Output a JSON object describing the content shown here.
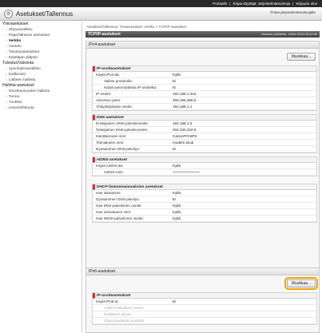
{
  "topbar": {
    "links": [
      "Portaalin",
      "Kirjaa käyttäjä: Järjestelmänvalvoja",
      "Kirjaudu ulos"
    ]
  },
  "header": {
    "title": "Asetukset/Tallennus",
    "admin_link": "Posta järjestelmänvalvojalle"
  },
  "sidebar": {
    "groups": [
      {
        "label": "Yleisasetukset",
        "items": [
          "Ohjausvalikko",
          "Paperilähteen asetukset",
          "Verkko",
          "Asetelu",
          "Tulostusasetukset",
          "Käyttäjän ylläpito"
        ]
      },
      {
        "label": "Tulostus/Valvonta",
        "items": [
          "Apuohjelmavalikko",
          "Kalibrointi",
          "Laitteen hallinta"
        ]
      },
      {
        "label": "Hallinta-asetukset",
        "items": [
          "Osoitetunnusten hallinta",
          "Tunna",
          "TunRite",
          "Lisenssi/Muuta"
        ]
      }
    ],
    "active": "Verkko"
  },
  "main": {
    "breadcrumb": "Asetukset/Tallennus: Yleisasetukset: Verkko > TCP/IP-asetukset",
    "title": "TCP/IP-asetukset",
    "updated": "Viimeksi päivitetty: 19/06 2019 05:41:50",
    "edit_label": "Muokkaa...",
    "ipv4": {
      "panel_title": "IPv4-asetukset",
      "ip_section": {
        "title": "IP-osoiteasetukset",
        "rows": [
          {
            "label": "Käytä IPv4:ää:",
            "value": "Kyllä",
            "indent": false
          },
          {
            "label": "Valitse protokolla:",
            "value": "Ei",
            "indent": true
          },
          {
            "label": "Käytä automaattista IP-osoitetta:",
            "value": "Ei",
            "indent": true
          },
          {
            "label": "IP-osoite:",
            "value": "192.168.1.234",
            "indent": false
          },
          {
            "label": "Aliverkon peite:",
            "value": "255.255.255.0",
            "indent": false
          },
          {
            "label": "Yhdyskäytävän osoite:",
            "value": "192.168.1.1",
            "indent": false
          }
        ]
      },
      "dns_section": {
        "title": "DNS-asetukset",
        "rows": [
          {
            "label": "Ensisijainen DNS-palvelinosoite:",
            "value": "192.168.1.5"
          },
          {
            "label": "Toissijainen DNS-palvelinosoite:",
            "value": "202.234.232.6"
          },
          {
            "label": "Isäntäkoneen nimi:",
            "value": "CanonFFA9F9"
          },
          {
            "label": "Toimialueen nimi:",
            "value": "modem.local"
          },
          {
            "label": "Dynaaminen DNS-päivitys:",
            "value": "Ei"
          }
        ]
      },
      "mdns_section": {
        "title": "mDNS-asetukset",
        "rows": [
          {
            "label": "Käytä mDNS:ää:",
            "value": "Kyllä",
            "indent": false
          },
          {
            "label": "mDNS-nimi:",
            "value": "",
            "indent": true
          }
        ]
      },
      "dhcp_section": {
        "title": "DHCP-lisäominaisuuksien asetukset",
        "rows": [
          {
            "label": "Hae isäntänimi:",
            "value": "Kyllä"
          },
          {
            "label": "Dynaaminen DNS-päivitys:",
            "value": "Ei"
          },
          {
            "label": "Hae DNS-palvelimen osoite:",
            "value": "Kyllä"
          },
          {
            "label": "Hae toimialueen nimi:",
            "value": "Kyllä"
          },
          {
            "label": "Hae WINS-palvelimen osoite:",
            "value": "Kyllä"
          }
        ]
      }
    },
    "ipv6": {
      "panel_title": "IPv6-asetukset",
      "ip_section": {
        "title": "IP-osoiteasetukset",
        "rows": [
          {
            "label": "Käytä IPv6:ta:",
            "value": "Ei",
            "faded": false,
            "indent": false
          },
          {
            "label": "Linkki-Paikallinen osoite:",
            "value": "",
            "faded": true,
            "indent": true
          },
          {
            "label": "Etuliitteen pituus:",
            "value": "",
            "faded": true,
            "indent": true
          },
          {
            "label": "Käytä staattista osoitetta:",
            "value": "",
            "faded": true,
            "indent": true
          }
        ]
      }
    }
  }
}
